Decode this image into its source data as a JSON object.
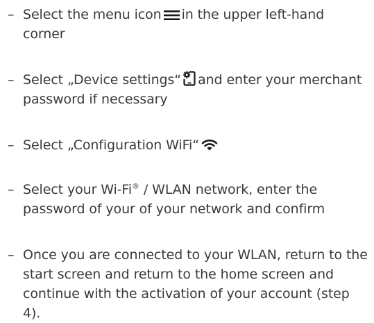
{
  "steps": [
    {
      "bullet": "–",
      "before_icon": "Select the menu icon",
      "icon": "hamburger-menu-icon",
      "after_icon": "in the upper left-hand corner"
    },
    {
      "bullet": "–",
      "before_icon": "Select „Device settings“",
      "icon": "device-settings-icon",
      "after_icon": "and enter your merchant password if necessary"
    },
    {
      "bullet": "–",
      "before_icon": "Select „Configuration WiFi“",
      "icon": "wifi-icon",
      "after_icon": ""
    },
    {
      "bullet": "–",
      "text_a": "Select your Wi-Fi",
      "registered": "®",
      "text_b": " / WLAN network, enter the password of your of your network and confirm"
    },
    {
      "bullet": "–",
      "text": "Once you are connected to your WLAN, return to the start screen and return to the home screen and continue with the activation of your account (step 4)."
    }
  ],
  "colors": {
    "text": "#3a3a3a",
    "icon": "#1a1a1a",
    "background": "#ffffff"
  }
}
